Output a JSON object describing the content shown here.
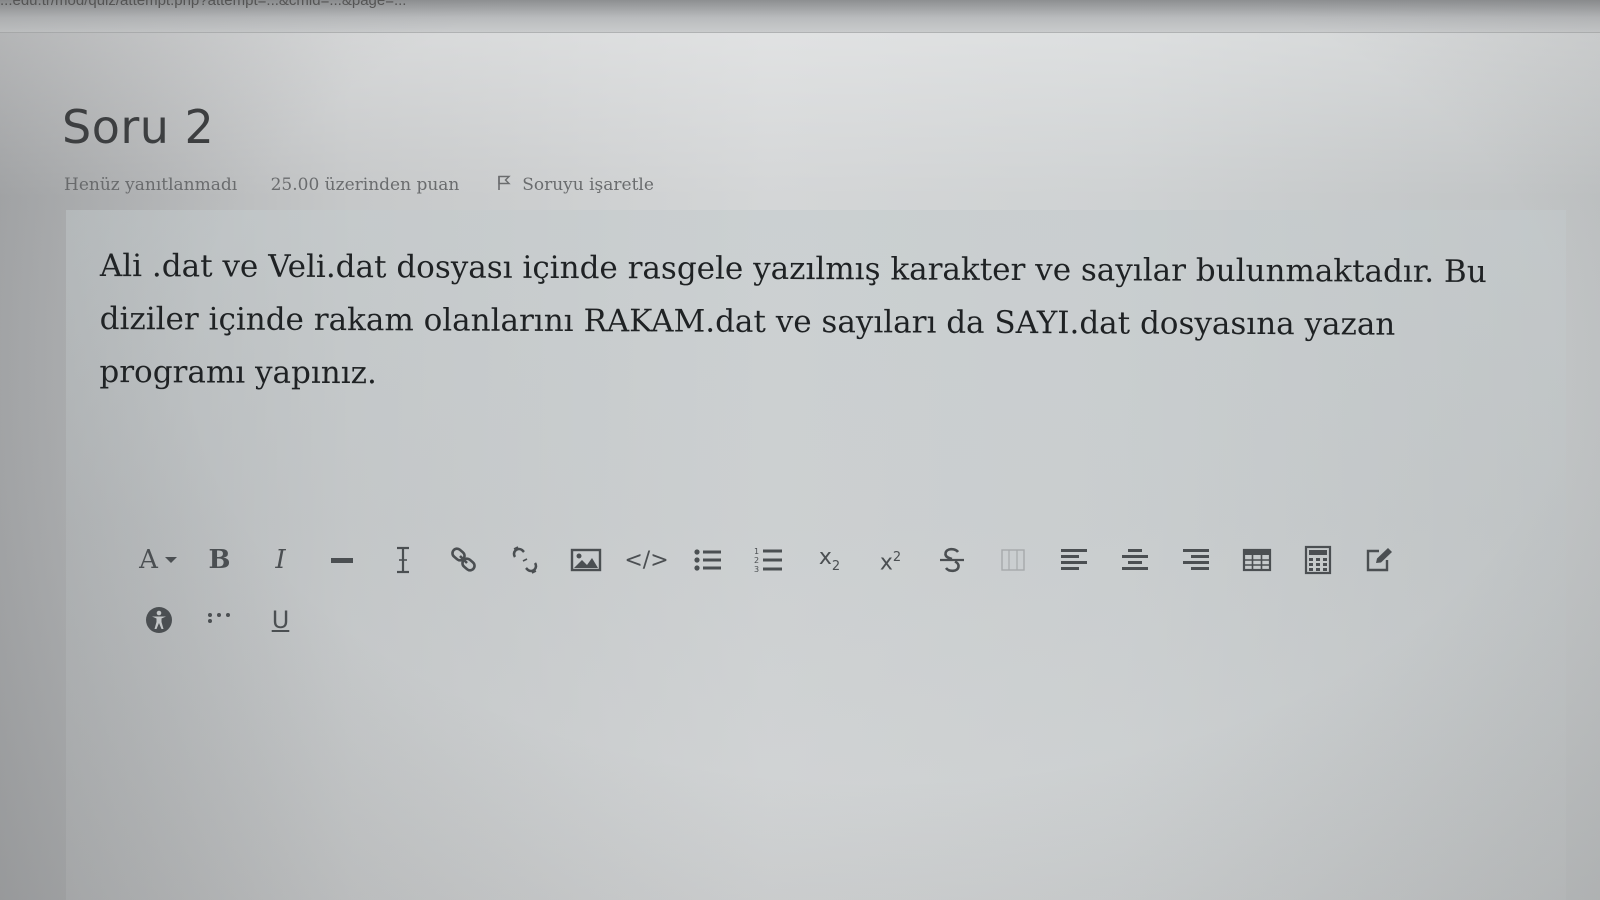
{
  "browser": {
    "url_fragment": "...edu.tr/mod/quiz/attempt.php?attempt=...&cmid=...&page=..."
  },
  "question": {
    "title": "Soru 2",
    "status": "Henüz yanıtlanmadı",
    "points": "25.00 üzerinden puan",
    "flag_label": "Soruyu işaretle",
    "text": "Ali .dat ve Veli.dat dosyası içinde rasgele yazılmış karakter ve sayılar bulunmaktadır.  Bu diziler içinde rakam olanlarını RAKAM.dat ve sayıları da SAYI.dat dosyasına yazan programı yapınız."
  },
  "editor": {
    "toolbar_row1": [
      {
        "id": "font-style",
        "label": "A",
        "icon": "font-style-icon"
      },
      {
        "id": "bold",
        "label": "B",
        "icon": "bold-icon"
      },
      {
        "id": "italic",
        "label": "I",
        "icon": "italic-icon"
      },
      {
        "id": "horizontal-rule",
        "label": "",
        "icon": "horizontal-rule-icon"
      },
      {
        "id": "clear-formatting",
        "label": "",
        "icon": "clear-formatting-icon"
      },
      {
        "id": "link",
        "label": "",
        "icon": "link-icon"
      },
      {
        "id": "unlink",
        "label": "",
        "icon": "unlink-icon"
      },
      {
        "id": "image",
        "label": "",
        "icon": "image-icon"
      },
      {
        "id": "html",
        "label": "</>",
        "icon": "code-icon"
      },
      {
        "id": "unordered-list",
        "label": "",
        "icon": "unordered-list-icon"
      },
      {
        "id": "ordered-list",
        "label": "",
        "icon": "ordered-list-icon"
      },
      {
        "id": "subscript",
        "label": "x",
        "sub": "2",
        "icon": "subscript-icon"
      },
      {
        "id": "superscript",
        "label": "x",
        "sup": "2",
        "icon": "superscript-icon"
      },
      {
        "id": "strikethrough",
        "label": "",
        "icon": "strikethrough-icon"
      },
      {
        "id": "special-char",
        "label": "",
        "icon": "special-char-icon"
      },
      {
        "id": "align-left",
        "label": "",
        "icon": "align-left-icon"
      },
      {
        "id": "align-center",
        "label": "",
        "icon": "align-center-icon"
      },
      {
        "id": "align-right",
        "label": "",
        "icon": "align-right-icon"
      },
      {
        "id": "table",
        "label": "",
        "icon": "table-icon"
      },
      {
        "id": "equation",
        "label": "",
        "icon": "calculator-icon"
      },
      {
        "id": "edit-html",
        "label": "",
        "icon": "edit-icon"
      }
    ],
    "toolbar_row2": [
      {
        "id": "accessibility-checker",
        "label": "",
        "icon": "accessibility-icon"
      },
      {
        "id": "more",
        "label": "",
        "icon": "more-dots-icon"
      },
      {
        "id": "underline",
        "label": "U",
        "icon": "underline-icon"
      }
    ],
    "content": ""
  },
  "colors": {
    "text": "#1f2224",
    "muted": "#6a6c6e",
    "toolbar_icon": "#4b4f52",
    "question_box": "#c4cbcd"
  }
}
